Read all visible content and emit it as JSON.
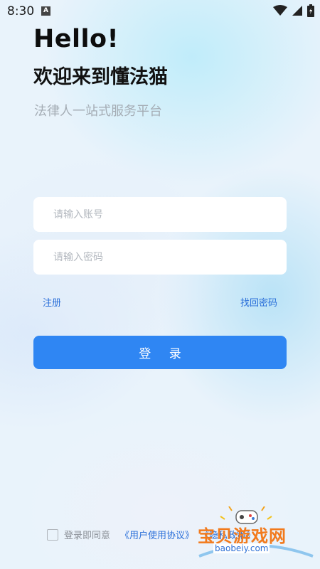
{
  "status_bar": {
    "time": "8:30",
    "notification_badge": "A"
  },
  "header": {
    "greeting": "Hello!",
    "welcome": "欢迎来到懂法猫",
    "subtitle": "法律人一站式服务平台"
  },
  "form": {
    "account_placeholder": "请输入账号",
    "password_placeholder": "请输入密码",
    "register_label": "注册",
    "forgot_label": "找回密码",
    "login_label": "登 录"
  },
  "agreement": {
    "checked": false,
    "prefix": "登录即同意",
    "user_agreement": "《用户使用协议》",
    "privacy_partial": "《隐私政策》"
  },
  "watermark": {
    "brand": "宝贝游戏网",
    "url": "baobeiy.com"
  },
  "colors": {
    "primary": "#2f86f3",
    "link": "#2a6fd9",
    "watermark_orange": "#f27a1c"
  }
}
